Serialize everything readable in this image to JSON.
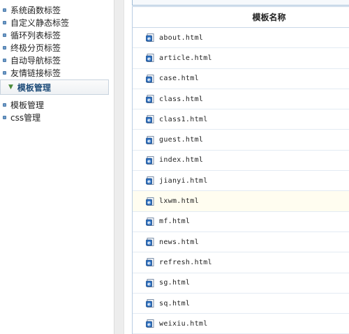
{
  "sidebar": {
    "items_top": [
      "系统函数标签",
      "自定义静态标签",
      "循环列表标签",
      "终极分页标签",
      "自动导航标签",
      "友情链接标签"
    ],
    "section": {
      "title": "模板管理"
    },
    "items_bottom": [
      "模板管理",
      "css管理"
    ]
  },
  "table": {
    "header": "模板名称",
    "highlighted_row": 8,
    "rows": [
      "about.html",
      "article.html",
      "case.html",
      "class.html",
      "class1.html",
      "guest.html",
      "index.html",
      "jianyi.html",
      "lxwm.html",
      "mf.html",
      "news.html",
      "refresh.html",
      "sg.html",
      "sq.html",
      "weixiu.html"
    ],
    "row_icon": "ie-html-file-icon"
  },
  "colors": {
    "accent": "#1f4d7a",
    "bullet": "#6f9cc9",
    "row_highlight": "#fffdf0"
  }
}
